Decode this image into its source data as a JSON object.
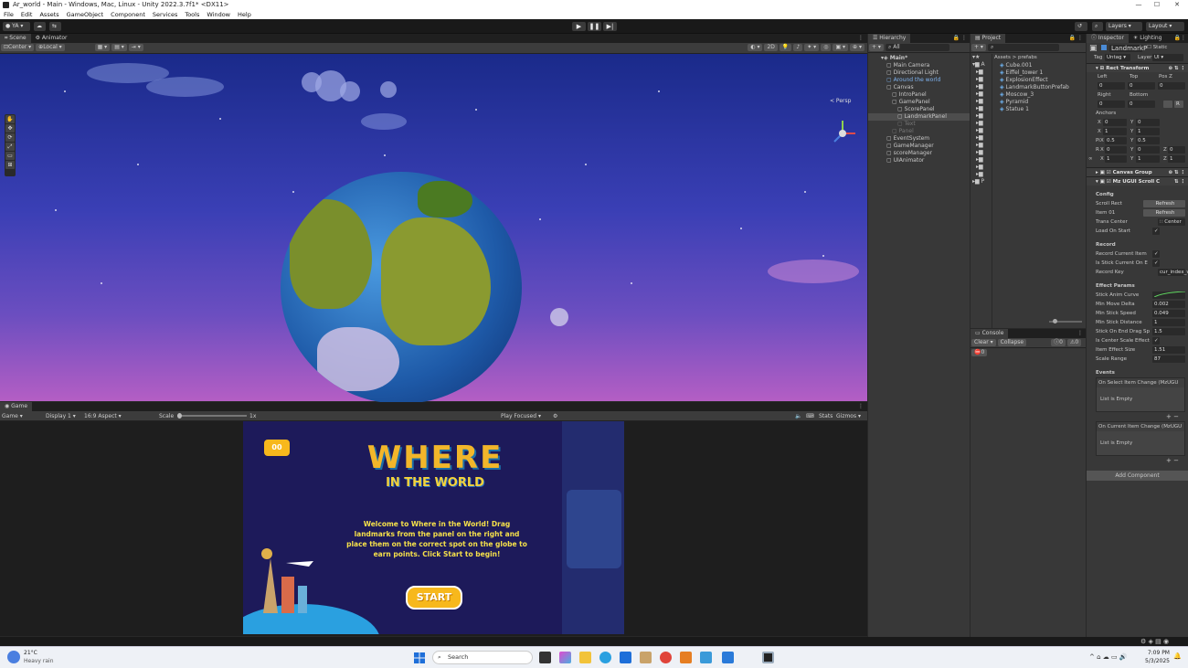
{
  "window": {
    "title": "Ar_world - Main - Windows, Mac, Linux - Unity 2022.3.7f1* <DX11>"
  },
  "menu": [
    "File",
    "Edit",
    "Assets",
    "GameObject",
    "Component",
    "Services",
    "Tools",
    "Window",
    "Help"
  ],
  "toolbar": {
    "account": "YA",
    "layers": "Layers",
    "layout": "Layout"
  },
  "scene": {
    "tabs": [
      "Scene",
      "Animator"
    ],
    "pivot": "Center",
    "space": "Local",
    "persp": "< Persp"
  },
  "game": {
    "tab": "Game",
    "mode": "Game",
    "display": "Display 1",
    "aspect": "16:9 Aspect",
    "scale_label": "Scale",
    "scale_value": "1x",
    "play_focused": "Play Focused",
    "stats": "Stats",
    "gizmos": "Gizmos"
  },
  "gameui": {
    "score": "00",
    "title_main": "WHERE",
    "title_sub": "IN THE WORLD",
    "welcome": "Welcome to Where in the World! Drag landmarks from the panel on the right and place them on the correct spot on the globe to earn points. Click Start to begin!",
    "start": "START"
  },
  "hierarchy": {
    "tab": "Hierarchy",
    "search": "All",
    "items": [
      {
        "label": "Main*",
        "depth": 0,
        "bold": true
      },
      {
        "label": "Main Camera",
        "depth": 1
      },
      {
        "label": "Directional Light",
        "depth": 1
      },
      {
        "label": "Around the world",
        "depth": 1,
        "blue": true
      },
      {
        "label": "Canvas",
        "depth": 1
      },
      {
        "label": "IntroPanel",
        "depth": 2
      },
      {
        "label": "GamePanel",
        "depth": 2
      },
      {
        "label": "ScorePanel",
        "depth": 3
      },
      {
        "label": "LandmarkPanel",
        "depth": 3,
        "selected": true
      },
      {
        "label": "Text",
        "depth": 3,
        "dim": true
      },
      {
        "label": "Panel",
        "depth": 2,
        "dim": true
      },
      {
        "label": "EventSystem",
        "depth": 1
      },
      {
        "label": "GameManager",
        "depth": 1
      },
      {
        "label": "scoreManager",
        "depth": 1
      },
      {
        "label": "UIAnimator",
        "depth": 1
      }
    ]
  },
  "project": {
    "tab": "Project",
    "breadcrumb": "Assets > prefabs",
    "items": [
      "Cube.001",
      "Eiffel_tower 1",
      "ExplosionEffect",
      "LandmarkButtonPrefab",
      "Moscow_3",
      "Pyramid",
      "Statue 1"
    ]
  },
  "console": {
    "tab": "Console",
    "clear": "Clear",
    "collapse": "Collapse",
    "count0": "0",
    "count1": "0",
    "count2": "0"
  },
  "inspector": {
    "tabs": [
      "Inspector",
      "Lighting"
    ],
    "object": "LandmarkP",
    "static": "Static",
    "tag_label": "Tag",
    "tag": "Untag",
    "layer_label": "Layer",
    "layer": "UI",
    "rect_transform": "Rect Transform",
    "left": "Left",
    "top": "Top",
    "posz": "Pos Z",
    "right": "Right",
    "bottom": "Bottom",
    "zero": "0",
    "anchors": "Anchors",
    "x": "X",
    "y": "Y",
    "z": "Z",
    "anchor_min_x": "0",
    "anchor_min_y": "0",
    "anchor_max_x": "1",
    "anchor_max_y": "1",
    "pivot_label": "Pivot",
    "pivot_x": "0.5",
    "pivot_y": "0.5",
    "rot_label": "Rotation",
    "rot": "0",
    "scale_label": "Scale",
    "scale": "1",
    "canvas_group": "Canvas Group",
    "scroll_comp": "Mz UGUI Scroll C",
    "config": "Config",
    "scroll_rect": "Scroll Rect",
    "item_01": "Item 01",
    "refresh": "Refresh",
    "trans_center": "Trans Center",
    "center": "Center",
    "load_on_start": "Load On Start",
    "record": "Record",
    "record_current_item": "Record Current Item",
    "is_stick_current": "Is Stick Current On E",
    "record_key": "Record Key",
    "record_key_val": "cur_index_va",
    "effect_params": "Effect Params",
    "stick_anim_curve": "Stick Anim Curve",
    "min_move_delta": "Min Move Delta",
    "min_move_delta_val": "0.002",
    "min_stick_speed": "Min Stick Speed",
    "min_stick_speed_val": "0.049",
    "min_stick_distance": "Min Stick Distance",
    "min_stick_distance_val": "1",
    "stick_on_end_drag": "Stick On End Drag Sp",
    "stick_on_end_drag_val": "1.5",
    "is_center_scale": "Is Center Scale Effect",
    "item_effect_size": "Item Effect Size",
    "item_effect_size_val": "1.51",
    "scale_range": "Scale Range",
    "scale_range_val": "87",
    "events": "Events",
    "on_select": "On Select Item Change (MzUGU",
    "list_empty": "List is Empty",
    "on_current": "On Current Item Change (MzUGU",
    "add_component": "Add Component"
  },
  "taskbar": {
    "weather_temp": "21°C",
    "weather_desc": "Heavy rain",
    "search": "Search",
    "time": "7:09 PM",
    "date": "5/3/2025"
  },
  "colors": {
    "accent": "#2c5d87",
    "unity_bg": "#383838",
    "scene_top": "#1a2a8a",
    "scene_bottom": "#b45ec4",
    "game_bg": "#1d1a5a",
    "start_btn": "#f7b81c"
  }
}
